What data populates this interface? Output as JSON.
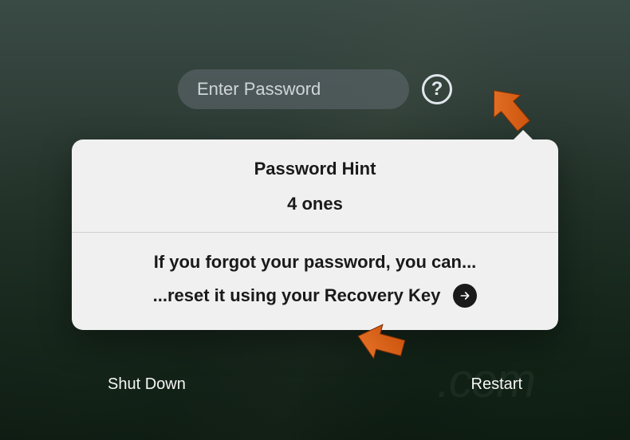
{
  "password": {
    "placeholder": "Enter Password"
  },
  "hint": {
    "title": "Password Hint",
    "value": "4 ones",
    "forgot_line1": "If you forgot your password, you can...",
    "forgot_line2": "...reset it using your Recovery Key"
  },
  "buttons": {
    "shutdown": "Shut Down",
    "restart": "Restart"
  }
}
